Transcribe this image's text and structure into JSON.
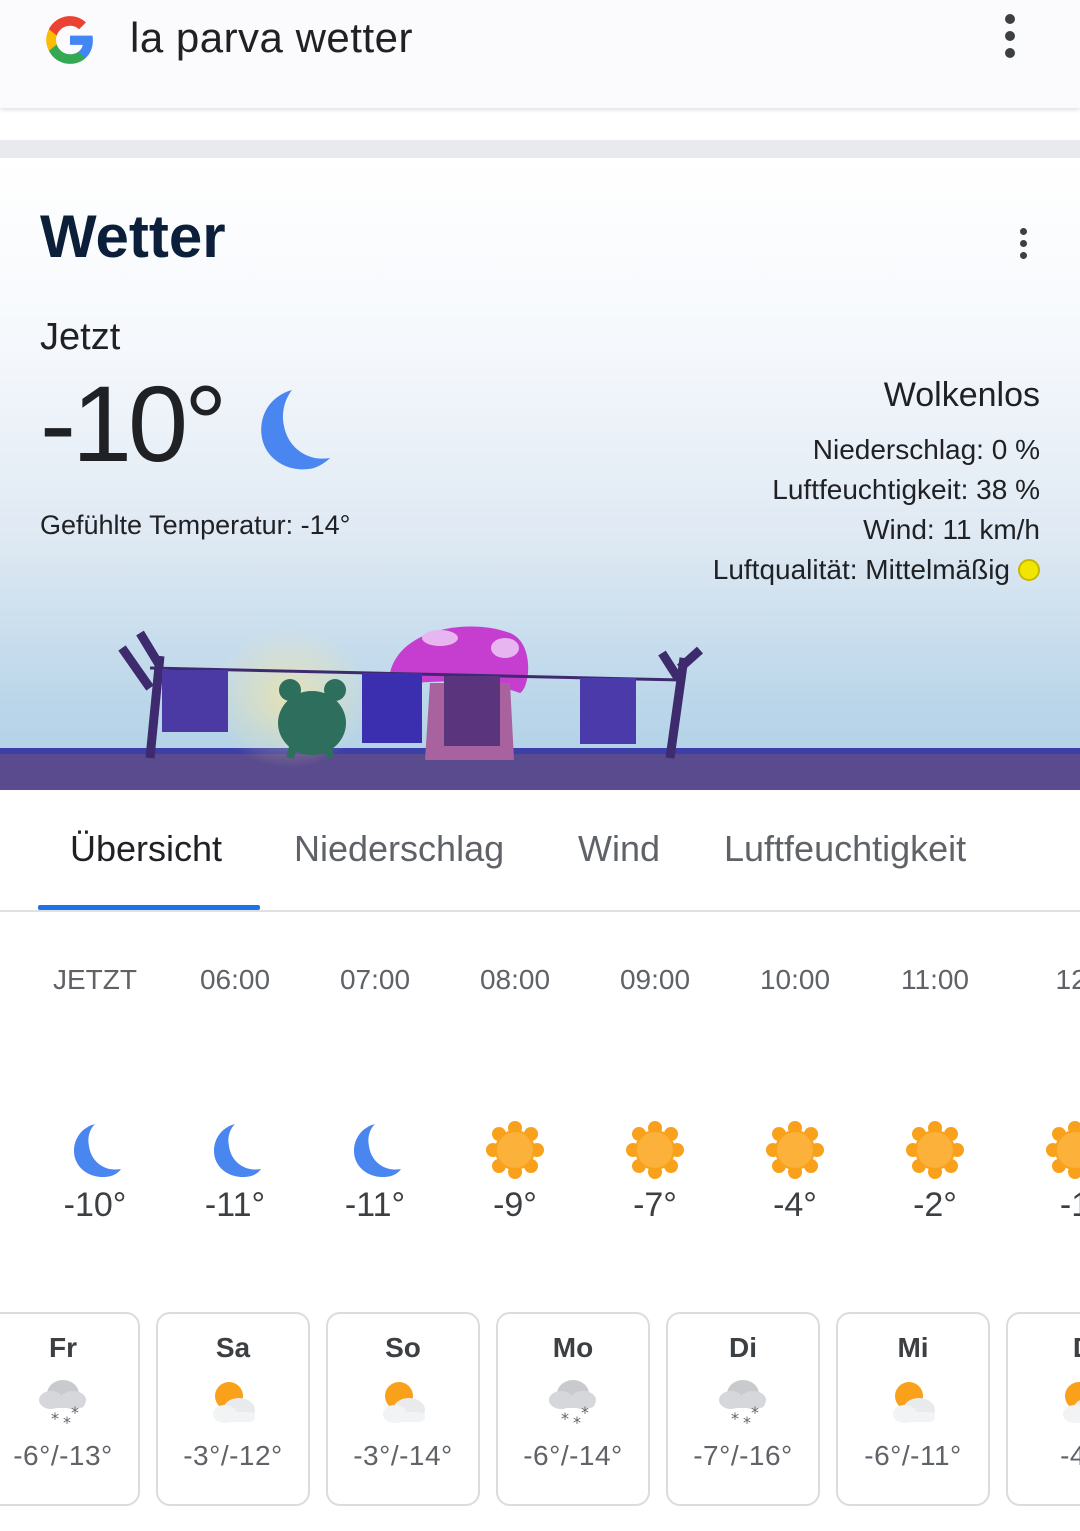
{
  "search": {
    "query": "la parva wetter",
    "menu_icon": "more-vert-icon"
  },
  "card": {
    "title": "Wetter",
    "menu_icon": "more-vert-icon",
    "now_label": "Jetzt",
    "temperature": "-10°",
    "condition_icon": "moon-icon",
    "feels_like": "Gefühlte Temperatur: -14°",
    "condition": "Wolkenlos",
    "precipitation": "Niederschlag: 0 %",
    "humidity": "Luftfeuchtigkeit: 38 %",
    "wind": "Wind: 11 km/h",
    "air_quality": "Luftqualität: Mittelmäßig",
    "air_quality_color": "#f2e600"
  },
  "tabs": [
    {
      "label": "Übersicht",
      "active": true
    },
    {
      "label": "Niederschlag",
      "active": false
    },
    {
      "label": "Wind",
      "active": false
    },
    {
      "label": "Luftfeuchtigkeit",
      "active": false
    }
  ],
  "hourly": [
    {
      "time": "JETZT",
      "icon": "moon-icon",
      "temp": "-10°"
    },
    {
      "time": "06:00",
      "icon": "moon-icon",
      "temp": "-11°"
    },
    {
      "time": "07:00",
      "icon": "moon-icon",
      "temp": "-11°"
    },
    {
      "time": "08:00",
      "icon": "sun-icon",
      "temp": "-9°"
    },
    {
      "time": "09:00",
      "icon": "sun-icon",
      "temp": "-7°"
    },
    {
      "time": "10:00",
      "icon": "sun-icon",
      "temp": "-4°"
    },
    {
      "time": "11:00",
      "icon": "sun-icon",
      "temp": "-2°"
    },
    {
      "time": "12:",
      "icon": "sun-icon",
      "temp": "-1"
    }
  ],
  "daily": [
    {
      "day": "Fr",
      "icon": "snow-cloud-icon",
      "temp": "-6°/-13°"
    },
    {
      "day": "Sa",
      "icon": "partly-cloudy-icon",
      "temp": "-3°/-12°"
    },
    {
      "day": "So",
      "icon": "partly-cloudy-icon",
      "temp": "-3°/-14°"
    },
    {
      "day": "Mo",
      "icon": "snow-cloud-icon",
      "temp": "-6°/-14°"
    },
    {
      "day": "Di",
      "icon": "snow-cloud-icon",
      "temp": "-7°/-16°"
    },
    {
      "day": "Mi",
      "icon": "partly-cloudy-icon",
      "temp": "-6°/-11°"
    },
    {
      "day": "D",
      "icon": "partly-cloudy-icon",
      "temp": "-4°/"
    }
  ],
  "colors": {
    "accent": "#1a73e8",
    "moon": "#4a86f0",
    "sun": "#f9a11b"
  }
}
